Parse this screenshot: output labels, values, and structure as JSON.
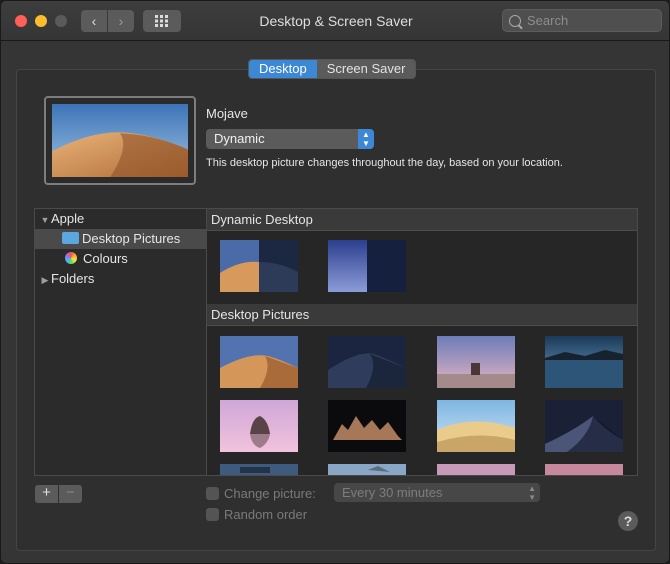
{
  "window": {
    "title": "Desktop & Screen Saver"
  },
  "toolbar": {
    "back_glyph": "‹",
    "forward_glyph": "›",
    "grid_glyph": "⋮⋮⋮",
    "search_placeholder": "Search"
  },
  "tabs": [
    {
      "label": "Desktop",
      "active": true
    },
    {
      "label": "Screen Saver",
      "active": false
    }
  ],
  "current": {
    "name": "Mojave",
    "mode": "Dynamic",
    "description": "This desktop picture changes throughout the day, based on your location."
  },
  "sidebar": {
    "apple_group": "Apple",
    "items": [
      {
        "label": "Desktop Pictures",
        "selected": true,
        "icon": "folder-icon"
      },
      {
        "label": "Colours",
        "selected": false,
        "icon": "colours-icon"
      }
    ],
    "folders_group": "Folders"
  },
  "sections": [
    {
      "title": "Dynamic Desktop"
    },
    {
      "title": "Desktop Pictures"
    }
  ],
  "footer": {
    "add_label": "+",
    "remove_label": "−",
    "change_picture_label": "Change picture:",
    "interval_value": "Every 30 minutes",
    "random_order_label": "Random order",
    "help_label": "?"
  },
  "colors": {
    "accent": "#3c88d4",
    "close": "#fe5f57",
    "minimize": "#febc2e"
  }
}
